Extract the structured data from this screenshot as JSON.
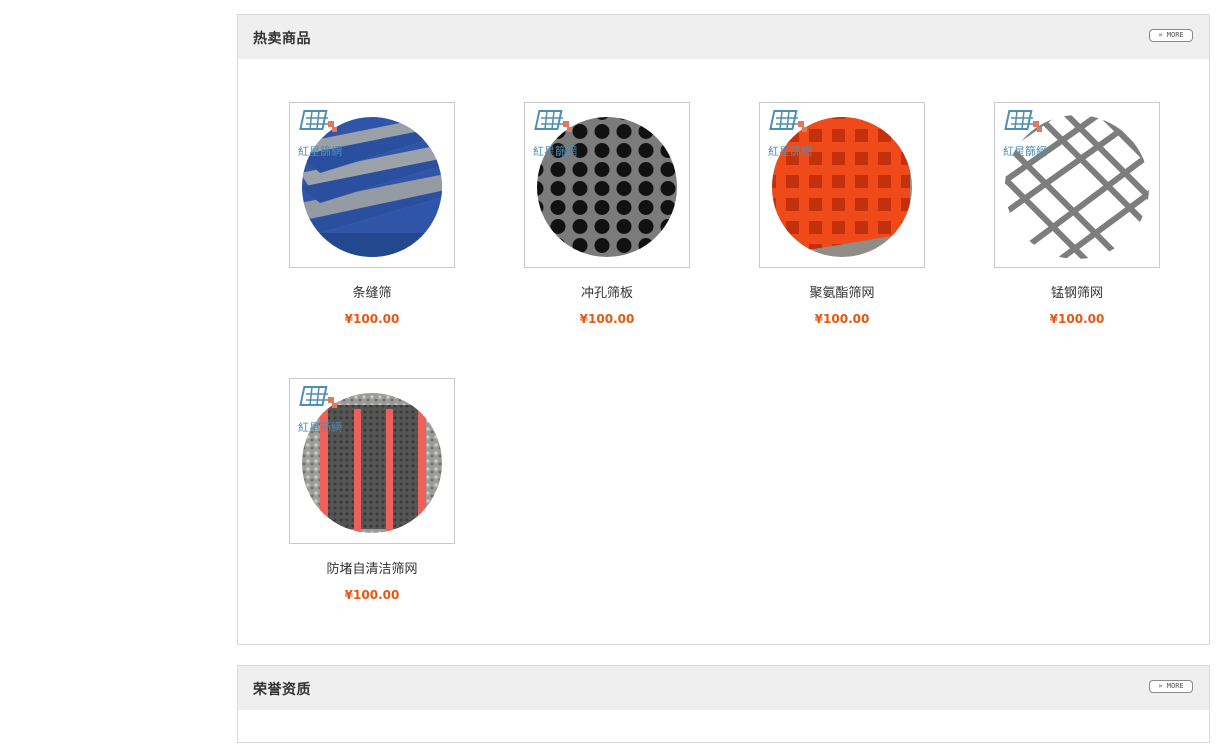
{
  "hot": {
    "title": "热卖商品",
    "more_label": "» MORE",
    "products": [
      {
        "name": "条缝筛",
        "price": "¥100.00",
        "image": "slot-screen-image"
      },
      {
        "name": "冲孔筛板",
        "price": "¥100.00",
        "image": "punched-plate-image"
      },
      {
        "name": "聚氨酯筛网",
        "price": "¥100.00",
        "image": "polyurethane-screen-image"
      },
      {
        "name": "锰钢筛网",
        "price": "¥100.00",
        "image": "manganese-steel-mesh-image"
      },
      {
        "name": "防堵自清洁筛网",
        "price": "¥100.00",
        "image": "anti-clog-screen-image"
      }
    ],
    "logo_text": "紅星篩網"
  },
  "honor": {
    "title": "荣誉资质",
    "more_label": "» MORE"
  },
  "colors": {
    "price": "#e8550f",
    "header_bg": "#efefef",
    "border": "#d9d9d9"
  }
}
